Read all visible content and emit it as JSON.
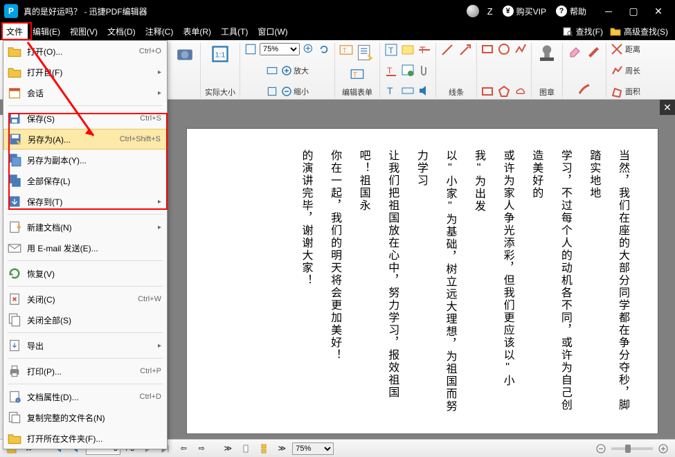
{
  "titlebar": {
    "title": "真的是好运吗？ - 迅捷PDF编辑器",
    "z": "Z",
    "vip": "购买VIP",
    "help": "帮助"
  },
  "menubar": {
    "items": [
      "文件",
      "编辑(E)",
      "视图(V)",
      "文档(D)",
      "注释(C)",
      "表单(R)",
      "工具(T)",
      "窗口(W)"
    ],
    "find": "查找(F)",
    "advfind": "高级查找(S)"
  },
  "toolbar": {
    "zoom_val": "75%",
    "actual_size": "实际大小",
    "zoom_in": "放大",
    "zoom_out": "缩小",
    "edit_form": "编辑表单",
    "lines": "线条",
    "stamp": "图章",
    "distance": "距离",
    "perimeter": "周长",
    "area": "面积"
  },
  "dropdown": {
    "open": "打开(O)...",
    "open_sc": "Ctrl+O",
    "open_from": "打开自(F)",
    "session": "会话",
    "save": "保存(S)",
    "save_sc": "Ctrl+S",
    "saveas": "另存为(A)...",
    "saveas_sc": "Ctrl+Shift+S",
    "savecopy": "另存为副本(Y)...",
    "saveall": "全部保存(L)",
    "saveto": "保存到(T)",
    "newdoc": "新建文档(N)",
    "email": "用 E-mail 发送(E)...",
    "restore": "恢复(V)",
    "close": "关闭(C)",
    "close_sc": "Ctrl+W",
    "closeall": "关闭全部(S)",
    "export": "导出",
    "print": "打印(P)...",
    "print_sc": "Ctrl+P",
    "props": "文档属性(D)...",
    "props_sc": "Ctrl+D",
    "copyname": "复制完整的文件名(N)",
    "openfolder": "打开所在文件夹(F)..."
  },
  "document": {
    "lines": [
      "当然，我们在座的大部分同学都在争分夺秒，脚踏实地地",
      "学习，不过每个人的动机各不同，或许为自己创造美好的",
      "或许为家人争光添彩，但我们更应该以\"小我\"为出发",
      "以\"小家\"为基础，树立远大理想，为祖国而努力学习",
      "让我们把祖国放在心中，努力学习，报效祖国吧！祖国永",
      "你在一起，我们的明天将会更加美好！",
      "的演讲完毕，谢谢大家！"
    ]
  },
  "statusbar": {
    "page_current": "3",
    "page_total": "/ 3",
    "zoom": "75%"
  }
}
